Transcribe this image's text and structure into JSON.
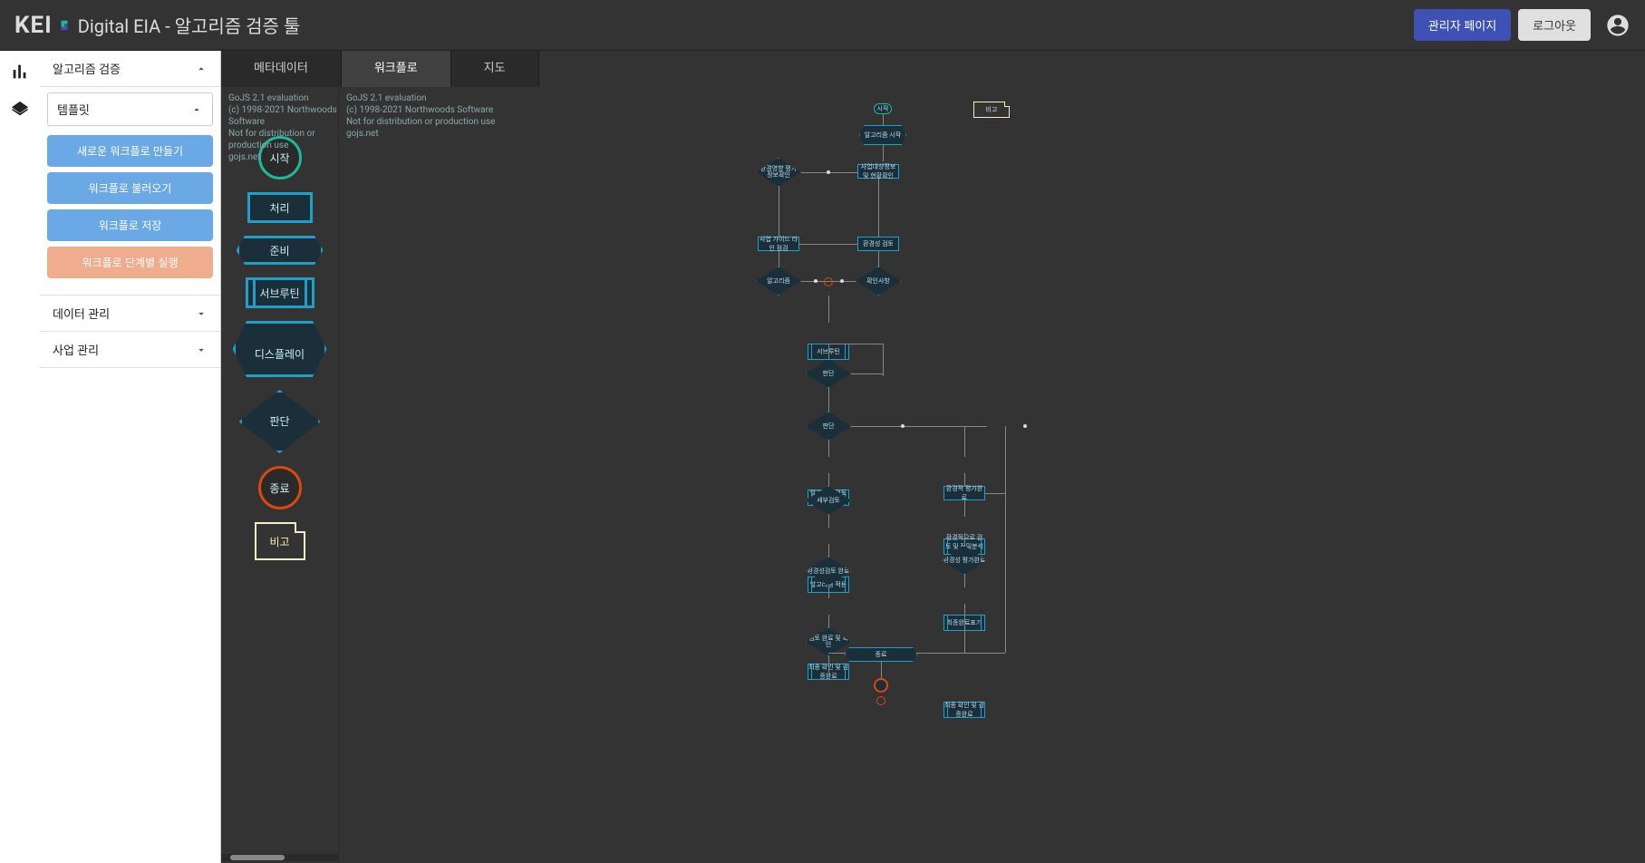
{
  "header": {
    "logo": "KEI",
    "title": "Digital EIA - 알고리즘 검증 툴",
    "admin_btn": "관리자 페이지",
    "logout_btn": "로그아웃"
  },
  "sidebar": {
    "sections": [
      {
        "label": "알고리즘 검증",
        "expanded": true
      },
      {
        "label": "데이터 관리",
        "expanded": false
      },
      {
        "label": "사업 관리",
        "expanded": false
      }
    ],
    "template_header": "템플릿",
    "template_buttons": {
      "new": "새로운 워크플로 만들기",
      "load": "워크플로 불러오기",
      "save": "워크플로 저장",
      "step": "워크플로 단계별 실행"
    }
  },
  "tabs": [
    {
      "label": "메타데이터",
      "active": false
    },
    {
      "label": "워크플로",
      "active": true
    },
    {
      "label": "지도",
      "active": false
    }
  ],
  "palette": {
    "start": "시작",
    "process": "처리",
    "prep": "준비",
    "subroutine": "서브루틴",
    "display": "디스플레이",
    "decision": "판단",
    "end": "종료",
    "note": "비고"
  },
  "watermark": {
    "line1": "GoJS 2.1 evaluation",
    "line2": "(c) 1998-2021 Northwoods Software",
    "line3": "Not for distribution or production use",
    "line4": "gojs.net"
  },
  "flow": {
    "note_label": "비고",
    "nodes_text": {
      "n1": "시작",
      "n2": "알고리즘 시작",
      "n3": "환경영향 평가 정보확인",
      "n4": "사업대상정보 및 현황확인",
      "n5": "사업 가이드 라인 점검",
      "n6": "환경성 검토",
      "n7": "알고리즘",
      "n8": "확인사항",
      "n9": "서브루틴",
      "n10": "판단",
      "n11": "알고리즘 검토 및 정밀분석",
      "n12": "세부검토",
      "n13": "판단",
      "n14": "환경적으로 검토 및 정밀분석 완료",
      "n15": "알고리즘 적용",
      "n16": "환경성검토 완료",
      "n17": "최종 확인 및 검증완료",
      "n18": "검토 완료 및 확인",
      "n19": "환경적 평가완료",
      "n20": "최종완료표기",
      "n21": "환경성 평가완료",
      "n22": "종료"
    }
  }
}
